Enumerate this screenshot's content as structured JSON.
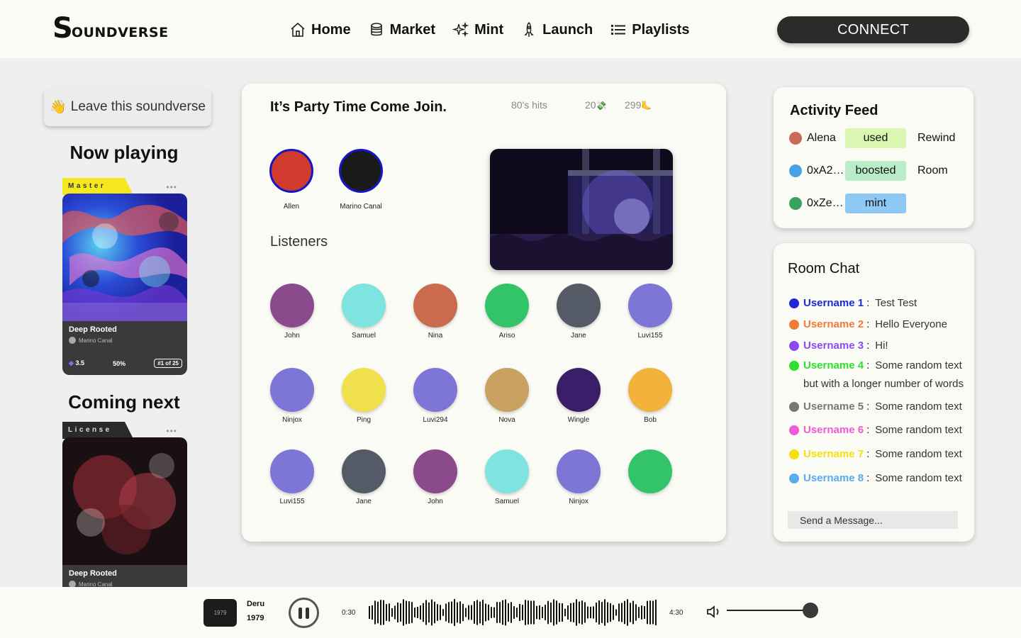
{
  "brand": {
    "logo_s": "S",
    "logo_rest": "OUNDVERSE"
  },
  "nav": [
    {
      "label": "Home",
      "icon": "home-icon"
    },
    {
      "label": "Market",
      "icon": "coins-icon"
    },
    {
      "label": "Mint",
      "icon": "sparkles-icon"
    },
    {
      "label": "Launch",
      "icon": "rocket-icon"
    },
    {
      "label": "Playlists",
      "icon": "list-icon"
    }
  ],
  "connect_label": "CONNECT",
  "left": {
    "leave_emoji": "👋",
    "leave_label": "Leave this soundverse",
    "now_playing_heading": "Now playing",
    "coming_next_heading": "Coming next",
    "now_card": {
      "tab": "Master",
      "title": "Deep Rooted",
      "artist": "Marino Canal",
      "eth": "3.5",
      "percent": "50%",
      "rank": "#1 of 25",
      "dots": "•••"
    },
    "next_card": {
      "tab": "License",
      "title": "Deep Rooted",
      "artist": "Marino Canal",
      "dots": "•••"
    }
  },
  "room": {
    "title": "It’s Party Time Come Join.",
    "genre": "80's hits",
    "stat1": "20",
    "stat1_icon": "💸",
    "stat2": "299",
    "stat2_icon": "🦶",
    "hosts": [
      {
        "name": "Allen",
        "color": "#d13b2e"
      },
      {
        "name": "Marino Canal",
        "color": "#1a1a1a"
      }
    ],
    "listeners_label": "Listeners",
    "listeners": [
      {
        "name": "John",
        "color": "#8a4a8c"
      },
      {
        "name": "Samuel",
        "color": "#7fe3e0"
      },
      {
        "name": "Nina",
        "color": "#c96b4c"
      },
      {
        "name": "Ariso",
        "color": "#33c46a"
      },
      {
        "name": "Jane",
        "color": "#555b66"
      },
      {
        "name": "Luvi155",
        "color": "#7d76d6"
      },
      {
        "name": "Ninjox",
        "color": "#7d76d6"
      },
      {
        "name": "Ping",
        "color": "#f0e04c"
      },
      {
        "name": "Luvi294",
        "color": "#7d76d6"
      },
      {
        "name": "Nova",
        "color": "#c9a160"
      },
      {
        "name": "Wingle",
        "color": "#3a1e6a"
      },
      {
        "name": "Bob",
        "color": "#f2b23b"
      },
      {
        "name": "Luvi155",
        "color": "#7d76d6"
      },
      {
        "name": "Jane",
        "color": "#555b66"
      },
      {
        "name": "John",
        "color": "#8a4a8c"
      },
      {
        "name": "Samuel",
        "color": "#7fe3e0"
      },
      {
        "name": "Ninjox",
        "color": "#7d76d6"
      },
      {
        "name": "",
        "color": "#33c46a"
      }
    ]
  },
  "activity": {
    "title": "Activity Feed",
    "rows": [
      {
        "name": "Alena",
        "action": "used",
        "target": "Rewind",
        "color": "#d9f7b0"
      },
      {
        "name": "0xA2…",
        "action": "boosted",
        "target": "Room",
        "color": "#b9ecc8"
      },
      {
        "name": "0xZe…",
        "action": "mint",
        "target": "",
        "color": "#8ec9f5"
      }
    ]
  },
  "chat": {
    "title": "Room Chat",
    "messages": [
      {
        "user": "Username 1",
        "sep": ":",
        "text": "Test Test",
        "color": "#1e2ad6"
      },
      {
        "user": "Username 2",
        "sep": ":",
        "text": "Hello Everyone",
        "color": "#f07c3a"
      },
      {
        "user": "Username 3",
        "sep": ":",
        "text": "Hi!",
        "color": "#8a4af0"
      },
      {
        "user": "Username 4",
        "sep": ":",
        "text": "Some random text",
        "cont": "but with a longer number of words",
        "color": "#2ee02e"
      },
      {
        "user": "Username 5",
        "sep": ":",
        "text": "Some random text",
        "color": "#777777"
      },
      {
        "user": "Username 6",
        "sep": ":",
        "text": "Some random text",
        "color": "#f05ad6"
      },
      {
        "user": "Username 7",
        "sep": ":",
        "text": "Some random text",
        "color": "#f2e20a"
      },
      {
        "user": "Username 8",
        "sep": ":",
        "text": "Some random text",
        "color": "#5aaaf0"
      }
    ],
    "placeholder": "Send a Message..."
  },
  "player": {
    "thumb_label": "1979",
    "artist": "Deru",
    "track": "1979",
    "elapsed": "0:30",
    "duration": "4:30",
    "volume": 1.0
  }
}
